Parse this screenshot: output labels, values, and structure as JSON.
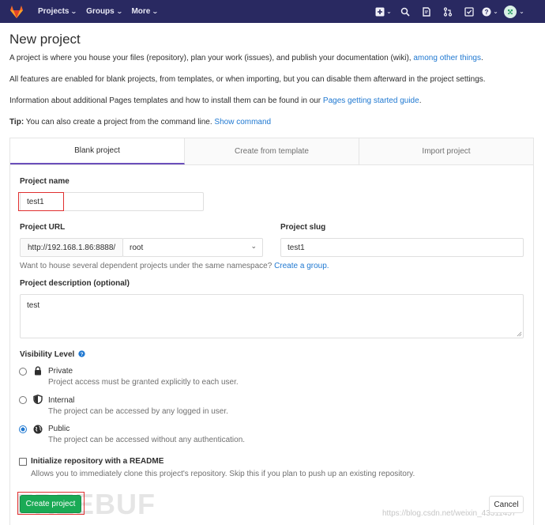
{
  "navbar": {
    "menu": [
      {
        "label": "Projects"
      },
      {
        "label": "Groups"
      },
      {
        "label": "More"
      }
    ],
    "icons": [
      "plus-square-icon",
      "chevron-down-icon",
      "search-icon",
      "issues-icon",
      "merge-request-icon",
      "todo-icon",
      "help-icon",
      "avatar"
    ]
  },
  "page": {
    "title": "New project",
    "intro_text": "A project is where you house your files (repository), plan your work (issues), and publish your documentation (wiki),",
    "intro_link": "among other things",
    "features_text": "All features are enabled for blank projects, from templates, or when importing, but you can disable them afterward in the project settings.",
    "pages_text": "Information about additional Pages templates and how to install them can be found in our",
    "pages_link": "Pages getting started guide",
    "tip_label": "Tip:",
    "tip_text": "You can also create a project from the command line.",
    "tip_link": "Show command"
  },
  "tabs": [
    {
      "label": "Blank project",
      "active": true
    },
    {
      "label": "Create from template",
      "active": false
    },
    {
      "label": "Import project",
      "active": false
    }
  ],
  "form": {
    "name_label": "Project name",
    "name_value": "test1",
    "url_label": "Project URL",
    "url_prefix": "http://192.168.1.86:8888/",
    "namespace_value": "root",
    "slug_label": "Project slug",
    "slug_value": "test1",
    "namespace_hint": "Want to house several dependent projects under the same namespace?",
    "namespace_link": "Create a group.",
    "description_label": "Project description (optional)",
    "description_value": "test",
    "visibility_label": "Visibility Level",
    "visibility_options": [
      {
        "title": "Private",
        "desc": "Project access must be granted explicitly to each user.",
        "checked": false
      },
      {
        "title": "Internal",
        "desc": "The project can be accessed by any logged in user.",
        "checked": false
      },
      {
        "title": "Public",
        "desc": "The project can be accessed without any authentication.",
        "checked": true
      }
    ],
    "readme_label": "Initialize repository with a README",
    "readme_desc": "Allows you to immediately clone this project's repository. Skip this if you plan to push up an existing repository.",
    "create_button": "Create project",
    "cancel_button": "Cancel"
  },
  "watermark": {
    "logo_text": "FREEBUF",
    "url_text": "https://blog.csdn.net/weixin_43311457"
  },
  "colors": {
    "navbar": "#292961",
    "link": "#1f78d1",
    "create_button": "#1aaa55",
    "active_tab_underline": "#6b4fbb",
    "highlight_box": "#e03030"
  }
}
